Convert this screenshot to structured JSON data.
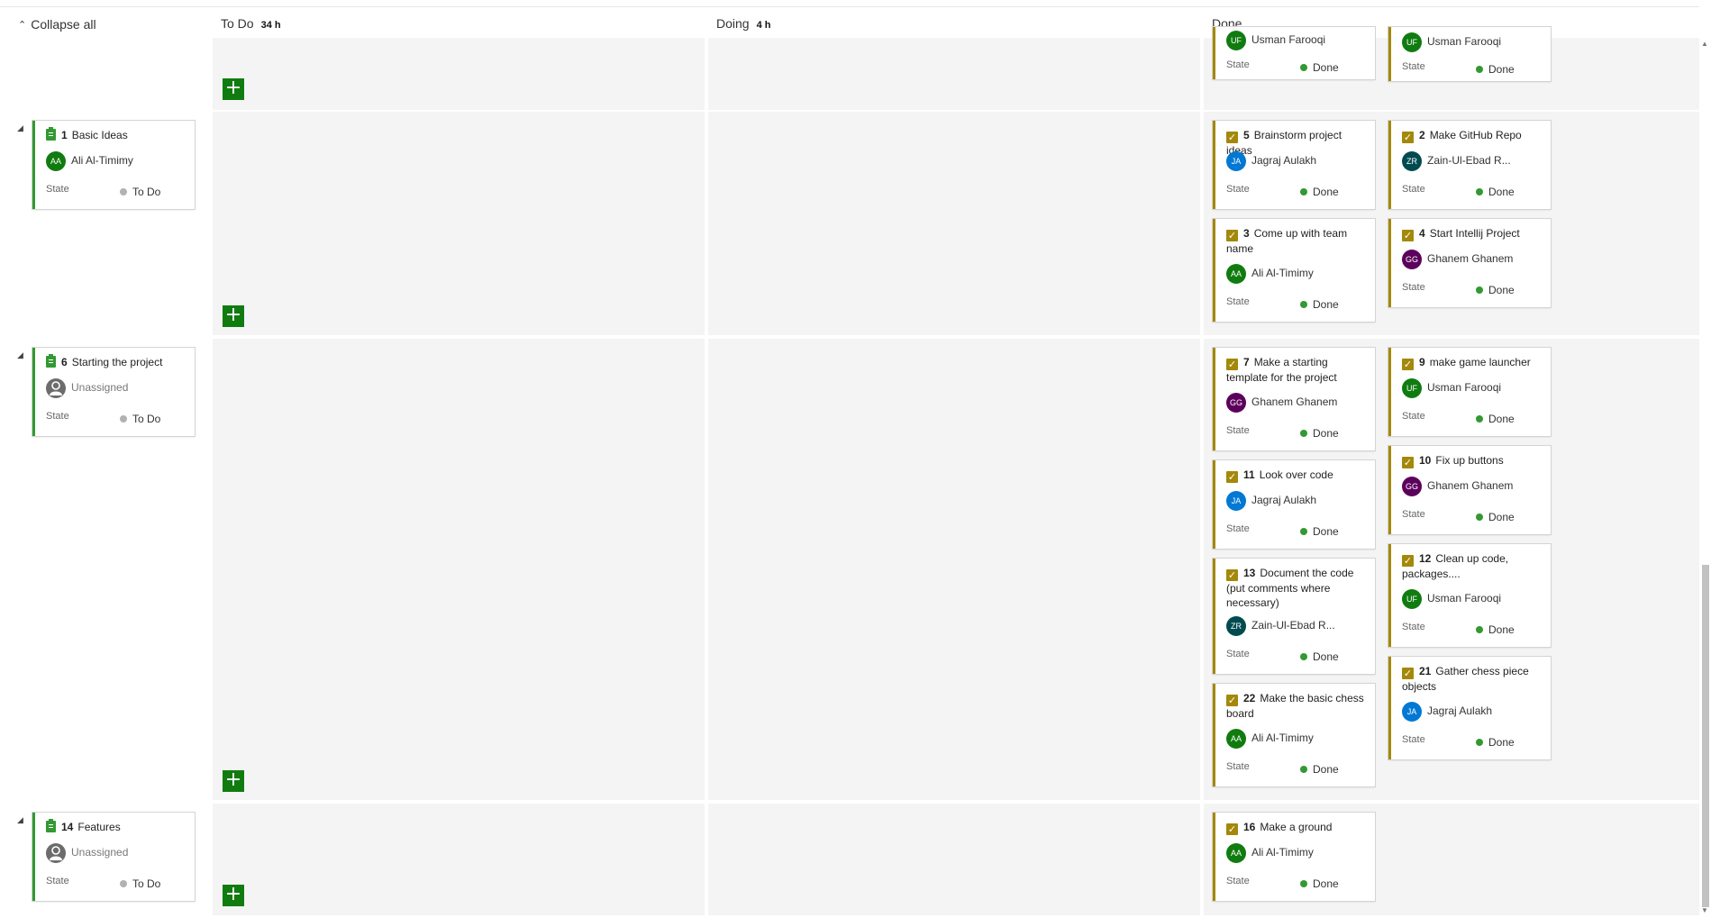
{
  "toolbar": {
    "collapse_all": "Collapse all"
  },
  "columns": [
    {
      "name": "To Do",
      "hours": "34 h"
    },
    {
      "name": "Doing",
      "hours": "4 h"
    },
    {
      "name": "Done",
      "hours": ""
    }
  ],
  "colors": {
    "pbi": "#339933",
    "task": "#a4880a",
    "add_button": "#107c10",
    "done_dot": "#339933",
    "todo_dot": "#b2b2b2"
  },
  "lanes": [
    {
      "parent": null,
      "done_cards": [
        {
          "assignee": "Usman Farooqi",
          "initials": "UF",
          "avatar_color": "#107c10",
          "state_label": "State",
          "state": "Done"
        },
        {
          "assignee": "Usman Farooqi",
          "initials": "UF",
          "avatar_color": "#107c10",
          "state_label": "State",
          "state": "Done"
        }
      ]
    },
    {
      "parent": {
        "id": "1",
        "title": "Basic Ideas",
        "assignee": "Ali Al-Timimy",
        "initials": "AA",
        "avatar_color": "#107c10",
        "state_label": "State",
        "state": "To Do"
      },
      "done_cards": [
        {
          "id": "5",
          "title": "Brainstorm project ideas",
          "assignee": "Jagraj Aulakh",
          "initials": "JA",
          "avatar_color": "#0078d4",
          "state_label": "State",
          "state": "Done"
        },
        {
          "id": "2",
          "title": "Make GitHub Repo",
          "assignee": "Zain-Ul-Ebad R...",
          "initials": "ZR",
          "avatar_color": "#004b50",
          "state_label": "State",
          "state": "Done"
        },
        {
          "id": "3",
          "title": "Come up with team name",
          "assignee": "Ali Al-Timimy",
          "initials": "AA",
          "avatar_color": "#107c10",
          "state_label": "State",
          "state": "Done"
        },
        {
          "id": "4",
          "title": "Start Intellij Project",
          "assignee": "Ghanem Ghanem",
          "initials": "GG",
          "avatar_color": "#5c005c",
          "state_label": "State",
          "state": "Done"
        }
      ]
    },
    {
      "parent": {
        "id": "6",
        "title": "Starting the project",
        "assignee": "Unassigned",
        "state_label": "State",
        "state": "To Do"
      },
      "done_cards": [
        {
          "id": "7",
          "title": "Make a starting template for the project",
          "assignee": "Ghanem Ghanem",
          "initials": "GG",
          "avatar_color": "#5c005c",
          "state_label": "State",
          "state": "Done"
        },
        {
          "id": "9",
          "title": "make game launcher",
          "assignee": "Usman Farooqi",
          "initials": "UF",
          "avatar_color": "#107c10",
          "state_label": "State",
          "state": "Done"
        },
        {
          "id": "10",
          "title": "Fix up buttons",
          "assignee": "Ghanem Ghanem",
          "initials": "GG",
          "avatar_color": "#5c005c",
          "state_label": "State",
          "state": "Done"
        },
        {
          "id": "11",
          "title": "Look over code",
          "assignee": "Jagraj Aulakh",
          "initials": "JA",
          "avatar_color": "#0078d4",
          "state_label": "State",
          "state": "Done"
        },
        {
          "id": "12",
          "title": "Clean up code, packages....",
          "assignee": "Usman Farooqi",
          "initials": "UF",
          "avatar_color": "#107c10",
          "state_label": "State",
          "state": "Done"
        },
        {
          "id": "13",
          "title": "Document the code (put comments where necessary)",
          "assignee": "Zain-Ul-Ebad R...",
          "initials": "ZR",
          "avatar_color": "#004b50",
          "state_label": "State",
          "state": "Done"
        },
        {
          "id": "21",
          "title": "Gather chess piece objects",
          "assignee": "Jagraj Aulakh",
          "initials": "JA",
          "avatar_color": "#0078d4",
          "state_label": "State",
          "state": "Done"
        },
        {
          "id": "22",
          "title": "Make the basic chess board",
          "assignee": "Ali Al-Timimy",
          "initials": "AA",
          "avatar_color": "#107c10",
          "state_label": "State",
          "state": "Done"
        }
      ]
    },
    {
      "parent": {
        "id": "14",
        "title": "Features",
        "assignee": "Unassigned",
        "state_label": "State",
        "state": "To Do"
      },
      "done_cards": [
        {
          "id": "16",
          "title": "Make a ground",
          "assignee": "Ali Al-Timimy",
          "initials": "AA",
          "avatar_color": "#107c10",
          "state_label": "State",
          "state": "Done"
        }
      ]
    }
  ]
}
